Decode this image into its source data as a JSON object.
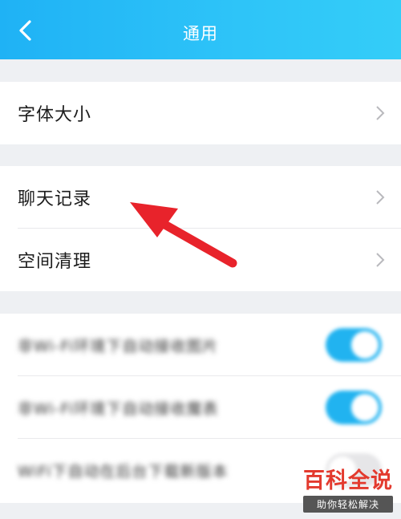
{
  "header": {
    "title": "通用"
  },
  "groups": {
    "font": {
      "label": "字体大小"
    },
    "chat": {
      "label": "聊天记录"
    },
    "space": {
      "label": "空间清理"
    }
  },
  "settings": [
    {
      "label": "非Wi-Fi环境下自动接收图片",
      "enabled": true
    },
    {
      "label": "非Wi-Fi环境下自动接收魔表",
      "enabled": true
    },
    {
      "label": "WiFi下自动在后台下载新版本",
      "enabled": false
    }
  ],
  "watermark": {
    "title": "百科全说",
    "subtitle": "助你轻松解决"
  },
  "colors": {
    "header": "#1fb2f5",
    "toggle_on": "#21b3f0",
    "arrow": "#e8232b",
    "watermark": "#e33a2e"
  }
}
